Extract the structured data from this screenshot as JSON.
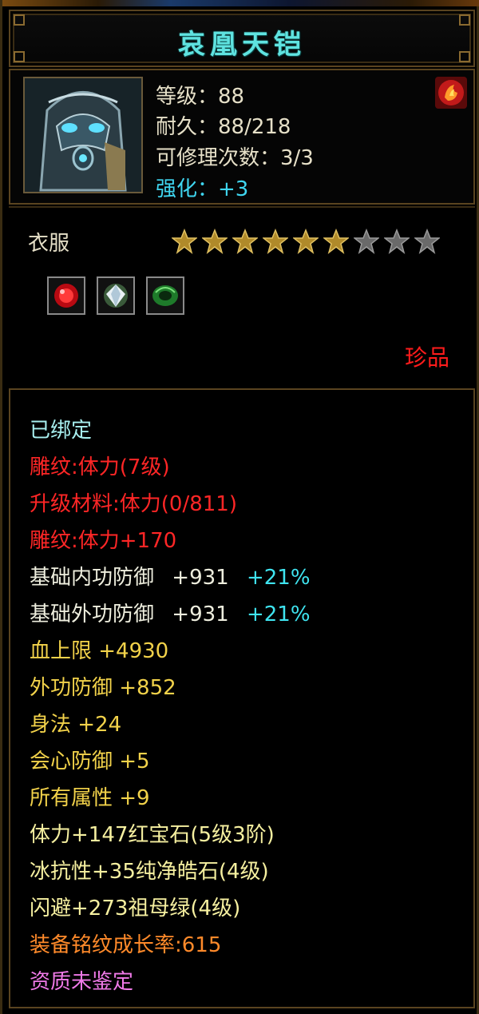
{
  "item": {
    "name": "哀凰天铠",
    "level": "等级：88",
    "durability": "耐久：88/218",
    "repairs": "可修理次数：3/3",
    "enhance": "强化：+3",
    "category": "衣服",
    "stars_total": 9,
    "stars_filled": 6,
    "quality": "珍品"
  },
  "gems": [
    "red-gem-icon",
    "diamond-gem-icon",
    "green-jade-icon"
  ],
  "attributes": {
    "bound": "已绑定",
    "engrave": "雕纹:体力(7级)",
    "upgrade_material": "升级材料:体力(0/811)",
    "engrave_bonus": "雕纹:体力+170",
    "inner_def_label": "基础内功防御",
    "inner_def_value": "+931",
    "inner_def_pct": "+21%",
    "outer_def_label": "基础外功防御",
    "outer_def_value": "+931",
    "outer_def_pct": "+21%",
    "hp": "血上限  +4930",
    "outer_def": "外功防御  +852",
    "agility": "身法  +24",
    "crit_def": "会心防御  +5",
    "all_attr": "所有属性  +9",
    "gem1": "体力+147红宝石(5级3阶)",
    "gem2": "冰抗性+35纯净皓石(4级)",
    "gem3": "闪避+273祖母绿(4级)",
    "growth": "装备铭纹成长率:615",
    "aptitude": "资质未鉴定"
  },
  "colors": {
    "title": "#5fe3e0",
    "red": "#ff2626",
    "yellow": "#f2d24a",
    "cyan": "#3fe4f0",
    "orange": "#ff8a2a",
    "pink": "#f07ae8"
  }
}
